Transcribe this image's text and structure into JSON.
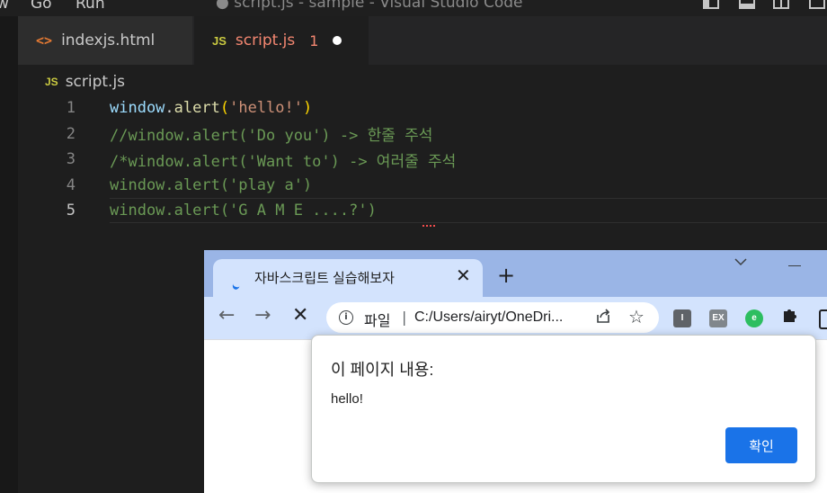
{
  "vscode": {
    "menu": [
      "w",
      "Go",
      "Run"
    ],
    "window_title": "● script.js - sample - Visual Studio Code",
    "tabs": [
      {
        "icon": "<>",
        "label": "indexjs.html"
      },
      {
        "icon": "JS",
        "label": "script.js",
        "problems": "1"
      }
    ],
    "breadcrumb": {
      "icon": "JS",
      "label": "script.js"
    },
    "code_lines": [
      {
        "num": "1",
        "tokens": [
          {
            "t": "window",
            "c": "c-var"
          },
          {
            "t": ".",
            "c": "c-punc"
          },
          {
            "t": "alert",
            "c": "c-fn"
          },
          {
            "t": "(",
            "c": "c-paren"
          },
          {
            "t": "'hello!'",
            "c": "c-str"
          },
          {
            "t": ")",
            "c": "c-paren"
          }
        ]
      },
      {
        "num": "2",
        "tokens": [
          {
            "t": "//window.alert('Do you') -> 한줄 주석",
            "c": "c-comment"
          }
        ]
      },
      {
        "num": "3",
        "tokens": [
          {
            "t": "/*window.alert('Want to') -> 여러줄 주석",
            "c": "c-comment"
          }
        ]
      },
      {
        "num": "4",
        "tokens": [
          {
            "t": "window.alert('play a')",
            "c": "c-comment"
          }
        ]
      },
      {
        "num": "5",
        "tokens": [
          {
            "t": "window.alert('G A M E ....?')",
            "c": "c-comment"
          }
        ]
      }
    ],
    "active_line": "5"
  },
  "browser": {
    "tab_title": "자바스크립트 실습해보자",
    "tab_close": "✕",
    "new_tab": "+",
    "nav": {
      "back": "←",
      "forward": "→",
      "stop": "✕"
    },
    "omnibox": {
      "scheme_label": "파일",
      "url": "C:/Users/airyt/OneDri..."
    },
    "extensions": {
      "i": "I",
      "ex": "EX",
      "evernote": "e"
    }
  },
  "dialog": {
    "title": "이 페이지 내용:",
    "message": "hello!",
    "ok_label": "확인"
  }
}
